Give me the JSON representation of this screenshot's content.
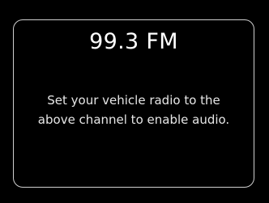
{
  "radio_prompt": {
    "frequency": "99.3 FM",
    "message_lines": [
      "Set your vehicle radio to the",
      "above channel to enable audio."
    ]
  },
  "colors": {
    "background": "#000000",
    "text": "#ffffff",
    "border": "#cfcfcf"
  }
}
